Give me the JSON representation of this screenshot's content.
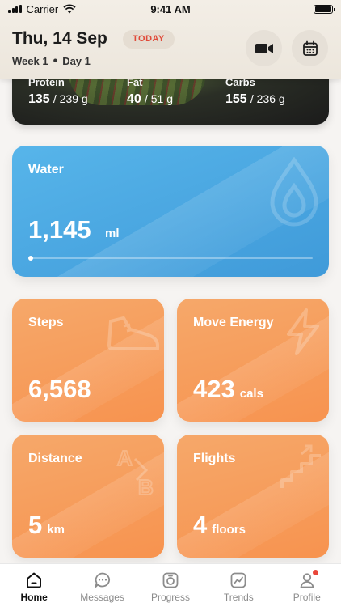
{
  "status_bar": {
    "carrier": "Carrier",
    "time": "9:41 AM"
  },
  "header": {
    "date": "Thu, 14 Sep",
    "badge": "TODAY",
    "week": "Week 1",
    "separator": "•",
    "day": "Day 1",
    "video_icon": "video-camera-icon",
    "calendar_icon": "calendar-icon"
  },
  "macros": [
    {
      "label": "Protein",
      "value": "135",
      "goal": "/ 239 g"
    },
    {
      "label": "Fat",
      "value": "40",
      "goal": "/ 51 g"
    },
    {
      "label": "Carbs",
      "value": "155",
      "goal": "/ 236 g"
    }
  ],
  "water": {
    "title": "Water",
    "value": "1,145",
    "unit": "ml",
    "progress": 0.0,
    "color": "#4aa8e3"
  },
  "tiles": {
    "steps": {
      "title": "Steps",
      "value": "6,568",
      "unit": ""
    },
    "energy": {
      "title": "Move Energy",
      "value": "423",
      "unit": "cals"
    },
    "distance": {
      "title": "Distance",
      "value": "5",
      "unit": "km"
    },
    "flights": {
      "title": "Flights",
      "value": "4",
      "unit": "floors"
    },
    "color": "#f79a58"
  },
  "tabbar": {
    "items": [
      {
        "label": "Home",
        "icon": "home-icon",
        "active": true
      },
      {
        "label": "Messages",
        "icon": "chat-icon",
        "active": false
      },
      {
        "label": "Progress",
        "icon": "scale-icon",
        "active": false
      },
      {
        "label": "Trends",
        "icon": "trend-chart-icon",
        "active": false
      },
      {
        "label": "Profile",
        "icon": "person-icon",
        "active": false
      }
    ]
  }
}
